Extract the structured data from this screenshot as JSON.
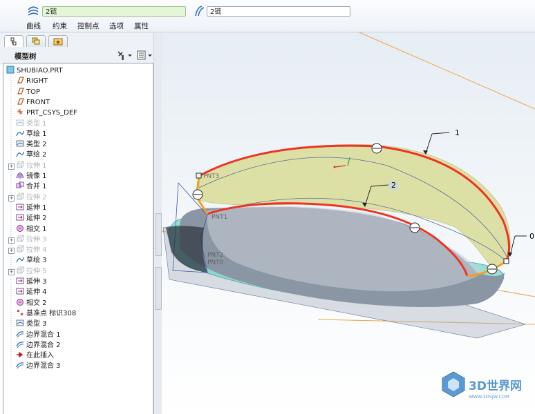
{
  "dashboard": {
    "first_chain_value": "2链",
    "second_chain_value": "2链",
    "tabs": [
      "曲线",
      "约束",
      "控制点",
      "选项",
      "属性"
    ]
  },
  "navigator": {
    "tabs": [
      "model-tree-tab",
      "layer-tree-tab",
      "favorites-tab"
    ],
    "header_title": "模型树",
    "items": [
      {
        "label": "SHUBIAO.PRT",
        "icon": "part-icon",
        "indent": 0,
        "dim": false,
        "expander": false
      },
      {
        "label": "RIGHT",
        "icon": "datum-plane-icon",
        "indent": 1,
        "dim": false,
        "expander": false
      },
      {
        "label": "TOP",
        "icon": "datum-plane-icon",
        "indent": 1,
        "dim": false,
        "expander": false
      },
      {
        "label": "FRONT",
        "icon": "datum-plane-icon",
        "indent": 1,
        "dim": false,
        "expander": false
      },
      {
        "label": "PRT_CSYS_DEF",
        "icon": "csys-icon",
        "indent": 1,
        "dim": false,
        "expander": false
      },
      {
        "label": "类型 1",
        "icon": "style-feature-icon",
        "indent": 1,
        "dim": true,
        "expander": false
      },
      {
        "label": "草绘 1",
        "icon": "sketch-icon",
        "indent": 1,
        "dim": false,
        "expander": false
      },
      {
        "label": "类型 2",
        "icon": "style-feature-icon",
        "indent": 1,
        "dim": false,
        "expander": false
      },
      {
        "label": "草绘 2",
        "icon": "sketch-icon",
        "indent": 1,
        "dim": false,
        "expander": false
      },
      {
        "label": "拉伸 1",
        "icon": "extrude-icon",
        "indent": 1,
        "dim": true,
        "expander": true
      },
      {
        "label": "镜像 1",
        "icon": "mirror-icon",
        "indent": 1,
        "dim": false,
        "expander": false
      },
      {
        "label": "合并 1",
        "icon": "merge-icon",
        "indent": 1,
        "dim": false,
        "expander": false
      },
      {
        "label": "拉伸 2",
        "icon": "extrude-icon",
        "indent": 1,
        "dim": true,
        "expander": true
      },
      {
        "label": "延伸 1",
        "icon": "extend-icon",
        "indent": 1,
        "dim": false,
        "expander": false
      },
      {
        "label": "延伸 2",
        "icon": "extend-icon",
        "indent": 1,
        "dim": false,
        "expander": false
      },
      {
        "label": "相交 1",
        "icon": "intersect-icon",
        "indent": 1,
        "dim": false,
        "expander": false
      },
      {
        "label": "拉伸 3",
        "icon": "extrude-icon",
        "indent": 1,
        "dim": true,
        "expander": true
      },
      {
        "label": "拉伸 4",
        "icon": "extrude-icon",
        "indent": 1,
        "dim": true,
        "expander": true
      },
      {
        "label": "草绘 3",
        "icon": "sketch-icon",
        "indent": 1,
        "dim": false,
        "expander": false
      },
      {
        "label": "拉伸 5",
        "icon": "extrude-icon",
        "indent": 1,
        "dim": true,
        "expander": true
      },
      {
        "label": "延伸 3",
        "icon": "extend-icon",
        "indent": 1,
        "dim": false,
        "expander": false
      },
      {
        "label": "延伸 4",
        "icon": "extend-icon",
        "indent": 1,
        "dim": false,
        "expander": false
      },
      {
        "label": "相交 2",
        "icon": "intersect-icon",
        "indent": 1,
        "dim": false,
        "expander": false
      },
      {
        "label": "基准点 标识308",
        "icon": "datum-point-icon",
        "indent": 1,
        "dim": false,
        "expander": false
      },
      {
        "label": "类型 3",
        "icon": "style-feature-icon",
        "indent": 1,
        "dim": false,
        "expander": false
      },
      {
        "label": "边界混合 1",
        "icon": "boundary-blend-icon",
        "indent": 1,
        "dim": false,
        "expander": false
      },
      {
        "label": "边界混合 2",
        "icon": "boundary-blend-icon",
        "indent": 1,
        "dim": false,
        "expander": false
      },
      {
        "label": "在此插入",
        "icon": "insert-here-arrow-icon",
        "indent": 1,
        "dim": false,
        "expander": false
      },
      {
        "label": "边界混合 3",
        "icon": "boundary-blend-icon",
        "indent": 1,
        "dim": false,
        "expander": false
      }
    ]
  },
  "viewport": {
    "chain_labels": [
      "1",
      "2",
      "0"
    ],
    "datum_points": [
      "PNT3",
      "PNT1",
      "PNT2",
      "PNT0"
    ],
    "watermark_text": "3D世界网",
    "watermark_url": "WWW.3DSJW.COM",
    "colors": {
      "chain_red": "#ee3322",
      "chain_orange": "#f0a020",
      "surface_yellow": "#d8dc96",
      "body_gray": "#8f9aa5",
      "datum_orange": "#e8a040",
      "shadow_teal": "#66d2c2"
    }
  }
}
